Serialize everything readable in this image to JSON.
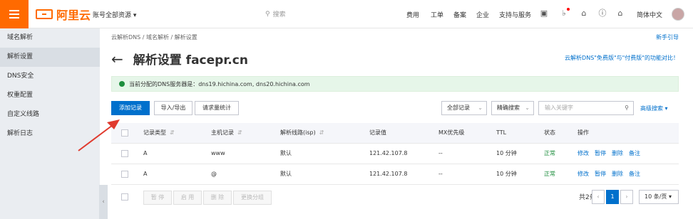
{
  "header": {
    "logo_text": "阿里云",
    "account": "账号全部资源 ▾",
    "search_placeholder": "搜索",
    "nav": [
      "费用",
      "工单",
      "备案",
      "企业",
      "支持与服务"
    ],
    "language": "简体中文"
  },
  "sidebar": {
    "items": [
      {
        "label": "域名解析"
      },
      {
        "label": "解析设置"
      },
      {
        "label": "DNS安全"
      },
      {
        "label": "权重配置"
      },
      {
        "label": "自定义线路"
      },
      {
        "label": "解析日志"
      }
    ],
    "active_index": 1
  },
  "breadcrumb": "云解析DNS / 域名解析 / 解析设置",
  "guide_link": "新手引导",
  "page_title": "解析设置 facepr.cn",
  "compare_link": "云解析DNS\"免费版\"与\"付费版\"的功能对比！",
  "notice": "当前分配的DNS服务器是：dns19.hichina.com, dns20.hichina.com",
  "toolbar": {
    "add_record": "添加记录",
    "import_export": "导入/导出",
    "request_stats": "请求量统计",
    "all_records": "全部记录",
    "precise_search": "精确搜索",
    "keyword_placeholder": "输入关键字",
    "advanced_search": "高级搜索 ▾"
  },
  "table": {
    "columns": [
      "记录类型",
      "主机记录",
      "解析线路(isp)",
      "记录值",
      "MX优先级",
      "TTL",
      "状态",
      "操作"
    ],
    "rows": [
      {
        "type": "A",
        "host": "www",
        "line": "默认",
        "value": "121.42.107.8",
        "mx": "--",
        "ttl": "10 分钟",
        "status": "正常"
      },
      {
        "type": "A",
        "host": "@",
        "line": "默认",
        "value": "121.42.107.8",
        "mx": "--",
        "ttl": "10 分钟",
        "status": "正常"
      }
    ],
    "actions": [
      "修改",
      "暂停",
      "删除",
      "备注"
    ]
  },
  "footer": {
    "pause": "暂 停",
    "enable": "启 用",
    "delete": "删 除",
    "change_group": "更换分组",
    "total": "共2条",
    "current_page": "1",
    "page_size": "10 条/页 ▾"
  },
  "colors": {
    "brand": "#ff6a00",
    "primary": "#0070cc",
    "ok": "#1e8e3e",
    "annotation": "#e03a2e"
  }
}
